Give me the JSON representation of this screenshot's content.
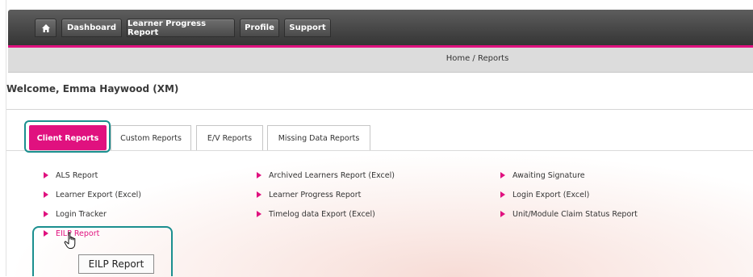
{
  "nav": {
    "home_icon": "home-icon",
    "items": [
      {
        "label": "Dashboard"
      },
      {
        "label": "Learner Progress Report"
      },
      {
        "label": "Profile"
      },
      {
        "label": "Support"
      }
    ]
  },
  "breadcrumb": "Home / Reports",
  "welcome": "Welcome, Emma Haywood (XM)",
  "tabs": [
    {
      "label": "Client Reports",
      "active": true
    },
    {
      "label": "Custom Reports"
    },
    {
      "label": "E/V Reports"
    },
    {
      "label": "Missing Data Reports"
    }
  ],
  "reports": {
    "col1": [
      "ALS Report",
      "Learner Export (Excel)",
      "Login Tracker",
      "EILP Report"
    ],
    "col2": [
      "Archived Learners Report (Excel)",
      "Learner Progress Report",
      "Timelog data Export (Excel)"
    ],
    "col3": [
      "Awaiting Signature",
      "Login Export (Excel)",
      "Unit/Module Claim Status Report"
    ]
  },
  "tooltip": "EILP Report",
  "colors": {
    "accent": "#e0117f",
    "highlight": "#1b8f8f"
  }
}
